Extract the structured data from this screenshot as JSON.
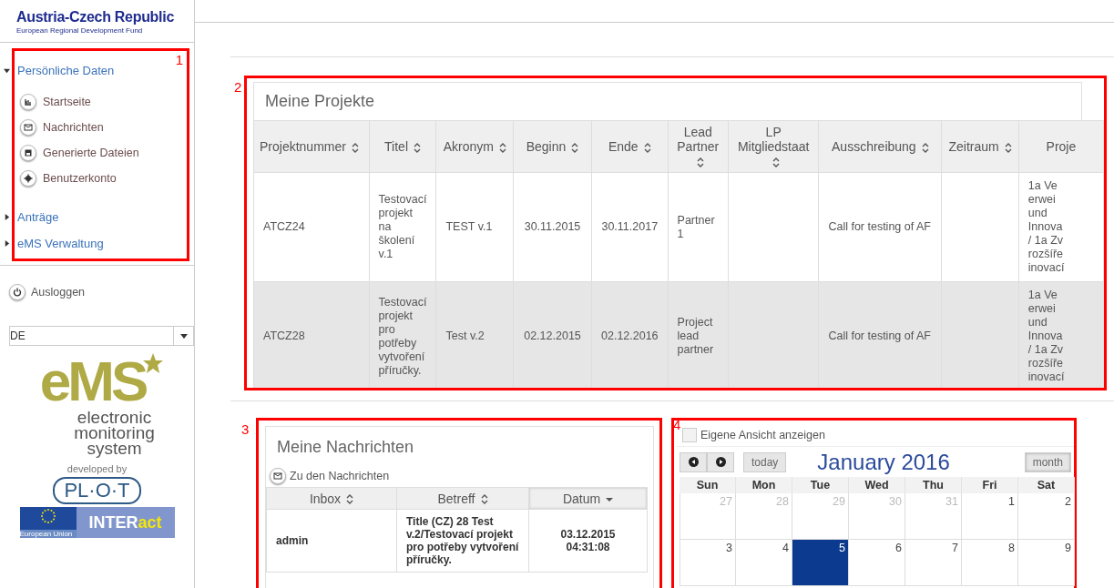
{
  "brand": {
    "title": "Austria-Czech Republic",
    "subtitle": "European Regional Development Fund"
  },
  "annotations": [
    "1",
    "2",
    "3",
    "4"
  ],
  "nav": [
    {
      "label": "Persönliche Daten",
      "expanded": true,
      "children": [
        {
          "label": "Startseite",
          "kind": "chart"
        },
        {
          "label": "Nachrichten",
          "kind": "mail"
        },
        {
          "label": "Generierte Dateien",
          "kind": "save"
        },
        {
          "label": "Benutzerkonto",
          "kind": "gear"
        }
      ]
    },
    {
      "label": "Anträge",
      "expanded": false
    },
    {
      "label": "eMS Verwaltung",
      "expanded": false
    }
  ],
  "logout": "Ausloggen",
  "language": {
    "value": "DE"
  },
  "ems_logo": {
    "mark": "eMS",
    "lines": [
      "electronic",
      "monitoring",
      "system"
    ],
    "developed_by": "developed by",
    "plot": "PL·O·T",
    "eu": "European Union",
    "interact_a": "INTER",
    "interact_b": "act"
  },
  "projects": {
    "title": "Meine Projekte",
    "columns": [
      {
        "label": "Projektnummer",
        "sortable": true
      },
      {
        "label": "Titel",
        "sortable": true
      },
      {
        "label": "Akronym",
        "sortable": true
      },
      {
        "label": "Beginn",
        "sortable": true
      },
      {
        "label": "Ende",
        "sortable": true
      },
      {
        "label": "Lead Partner",
        "sortable": true
      },
      {
        "label": "LP Mitgliedstaat",
        "sortable": true
      },
      {
        "label": "Ausschreibung",
        "sortable": true
      },
      {
        "label": "Zeitraum",
        "sortable": true
      },
      {
        "label": "Proje",
        "sortable": false
      }
    ],
    "rows": [
      {
        "cells": [
          "ATCZ24",
          "Testovací projekt na školení v.1",
          "TEST v.1",
          "30.11.2015",
          "30.11.2017",
          "Partner 1",
          "",
          "Call for testing of AF",
          ""
        ],
        "column_10": [
          "1a Ve",
          "erwei",
          "und",
          "Innova",
          "/ 1a Zv",
          "rozšíře",
          "inovací"
        ]
      },
      {
        "cells": [
          "ATCZ28",
          "Testovací projekt pro potřeby vytvoření příručky.",
          "Test v.2",
          "02.12.2015",
          "02.12.2016",
          "Project lead partner",
          "",
          "Call for testing of AF",
          ""
        ],
        "column_10": [
          "1a Ve",
          "erwei",
          "und",
          "Innova",
          "/ 1a Zv",
          "rozšíře",
          "inovací"
        ]
      }
    ]
  },
  "messages": {
    "title": "Meine Nachrichten",
    "link": "Zu den Nachrichten",
    "columns": [
      {
        "label": "Inbox",
        "selected": false
      },
      {
        "label": "Betreff",
        "selected": false
      },
      {
        "label": "Datum",
        "selected": true
      }
    ],
    "rows": [
      {
        "cells": [
          "admin",
          "Title (CZ) 28 Test v.2/Testovací projekt pro potřeby vytvoření příručky.",
          "03.12.2015 04:31:08"
        ],
        "unread": true
      }
    ]
  },
  "calendar": {
    "own_view": {
      "label": "Eigene Ansicht anzeigen",
      "checked": false
    },
    "today_button": "today",
    "title": "January 2016",
    "view_button": "month",
    "weekdays": [
      "Sun",
      "Mon",
      "Tue",
      "Wed",
      "Thu",
      "Fri",
      "Sat"
    ],
    "weeks": [
      [
        {
          "day": "27",
          "other_month": true,
          "today": false
        },
        {
          "day": "28",
          "other_month": true,
          "today": false
        },
        {
          "day": "29",
          "other_month": true,
          "today": false
        },
        {
          "day": "30",
          "other_month": true,
          "today": false
        },
        {
          "day": "31",
          "other_month": true,
          "today": false
        },
        {
          "day": "1",
          "other_month": false,
          "today": false
        },
        {
          "day": "2",
          "other_month": false,
          "today": false
        }
      ],
      [
        {
          "day": "3",
          "other_month": false,
          "today": false
        },
        {
          "day": "4",
          "other_month": false,
          "today": false
        },
        {
          "day": "5",
          "other_month": false,
          "today": true
        },
        {
          "day": "6",
          "other_month": false,
          "today": false
        },
        {
          "day": "7",
          "other_month": false,
          "today": false
        },
        {
          "day": "8",
          "other_month": false,
          "today": false
        },
        {
          "day": "9",
          "other_month": false,
          "today": false
        }
      ]
    ]
  }
}
